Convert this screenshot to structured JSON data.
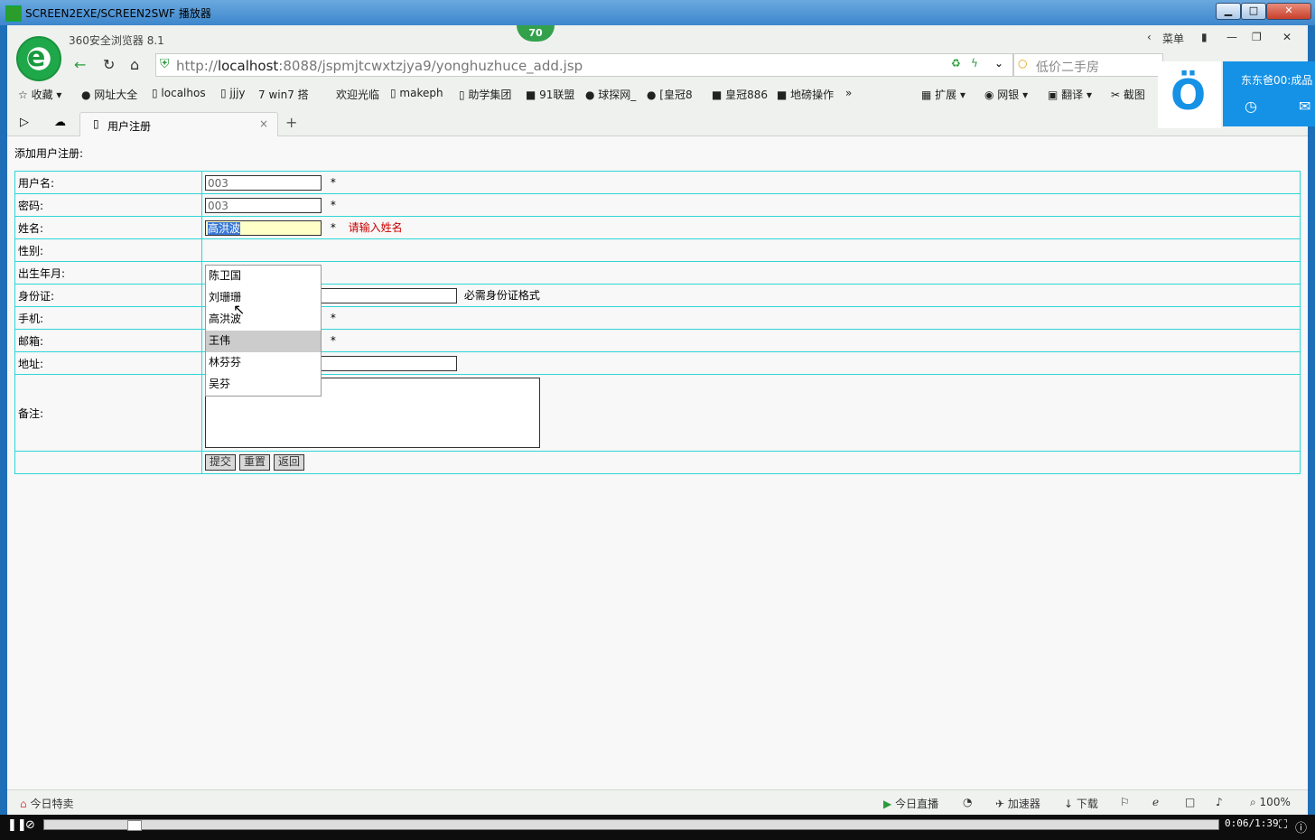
{
  "window": {
    "title": "SCREEN2EXE/SCREEN2SWF 播放器",
    "min": "▁",
    "max": "□",
    "close": "✕"
  },
  "browser": {
    "brand": "360安全浏览器 8.1",
    "badge": "70",
    "menu_label": "菜单",
    "url_prefix": "http://",
    "url_host": "localhost",
    "url_rest": ":8088/jspmjtcwxtzjya9/yonghuzhuce_add.jsp",
    "search_placeholder": "低价二手房",
    "bookmarks": [
      "收藏",
      "网址大全",
      "localhos",
      "jjjy",
      "win7 搭",
      "欢迎光临",
      "makeph",
      "助学集团",
      "91联盟",
      "球探网_",
      "[皇冠8",
      "皇冠886",
      "地磅操作"
    ],
    "toolbar_right": [
      "扩展",
      "网银",
      "翻译",
      "截图"
    ],
    "tab_title": "用户注册",
    "new_tab": "+"
  },
  "widget": {
    "text": "东东爸00:成品"
  },
  "form": {
    "title": "添加用户注册:",
    "labels": {
      "username": "用户名:",
      "password": "密码:",
      "name": "姓名:",
      "gender": "性别:",
      "birth": "出生年月:",
      "idcard": "身份证:",
      "phone": "手机:",
      "email": "邮箱:",
      "address": "地址:",
      "remark": "备注:"
    },
    "values": {
      "username": "003",
      "password": "003",
      "name": "高洪波"
    },
    "required_mark": "*",
    "name_error": "请输入姓名",
    "idcard_hint": "必需身份证格式",
    "buttons": {
      "submit": "提交",
      "reset": "重置",
      "back": "返回"
    }
  },
  "autocomplete": [
    "陈卫国",
    "刘珊珊",
    "高洪波",
    "王伟",
    "林芬芬",
    "吴芬"
  ],
  "statusbar": {
    "left": "今日特卖",
    "right": [
      "今日直播",
      "加速器",
      "下载"
    ],
    "zoom": "100%"
  },
  "player": {
    "time": "0:06/1:39"
  }
}
